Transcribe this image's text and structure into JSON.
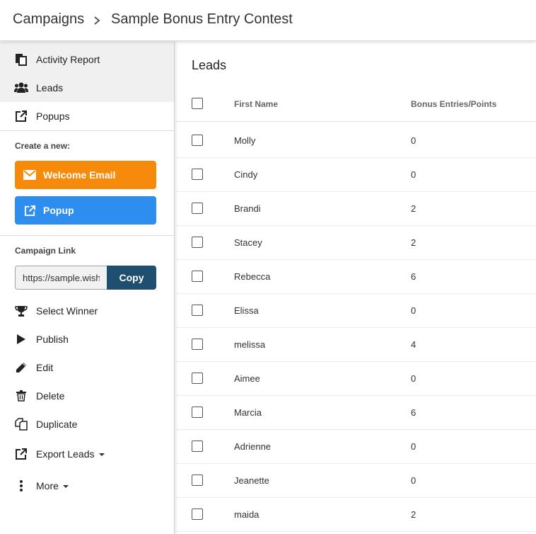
{
  "header": {
    "breadcrumb_root": "Campaigns",
    "breadcrumb_current": "Sample Bonus Entry Contest"
  },
  "sidebar": {
    "nav": [
      {
        "label": "Activity Report",
        "icon": "report-icon",
        "active": true
      },
      {
        "label": "Leads",
        "icon": "users-icon",
        "active": true
      },
      {
        "label": "Popups",
        "icon": "external-link-icon",
        "active": false
      }
    ],
    "create_label": "Create a new:",
    "create_buttons": [
      {
        "label": "Welcome Email",
        "icon": "envelope-icon",
        "color": "#f68a0b"
      },
      {
        "label": "Popup",
        "icon": "external-link-icon",
        "color": "#2d8ef0"
      }
    ],
    "campaign_link_label": "Campaign Link",
    "campaign_link_value": "https://sample.wishpond.com",
    "copy_label": "Copy",
    "actions": [
      {
        "label": "Select Winner",
        "icon": "trophy-icon"
      },
      {
        "label": "Publish",
        "icon": "play-icon"
      },
      {
        "label": "Edit",
        "icon": "pencil-icon"
      },
      {
        "label": "Delete",
        "icon": "trash-icon"
      },
      {
        "label": "Duplicate",
        "icon": "duplicate-icon"
      },
      {
        "label": "Export Leads",
        "icon": "external-link-icon",
        "dropdown": true
      },
      {
        "label": "More",
        "icon": "vertical-dots-icon",
        "dropdown": true
      }
    ]
  },
  "main": {
    "title": "Leads",
    "columns": [
      "First Name",
      "Bonus Entries/Points"
    ],
    "rows": [
      {
        "first_name": "Molly",
        "points": "0"
      },
      {
        "first_name": "Cindy",
        "points": "0"
      },
      {
        "first_name": "Brandi",
        "points": "2"
      },
      {
        "first_name": "Stacey",
        "points": "2"
      },
      {
        "first_name": "Rebecca",
        "points": "6"
      },
      {
        "first_name": "Elissa",
        "points": "0"
      },
      {
        "first_name": "melissa",
        "points": "4"
      },
      {
        "first_name": "Aimee",
        "points": "0"
      },
      {
        "first_name": "Marcia",
        "points": "6"
      },
      {
        "first_name": "Adrienne",
        "points": "0"
      },
      {
        "first_name": "Jeanette",
        "points": "0"
      },
      {
        "first_name": "maida",
        "points": "2"
      }
    ]
  },
  "colors": {
    "accent_orange": "#f68a0b",
    "accent_blue": "#2d8ef0",
    "copy_button": "#1f4f6e"
  }
}
